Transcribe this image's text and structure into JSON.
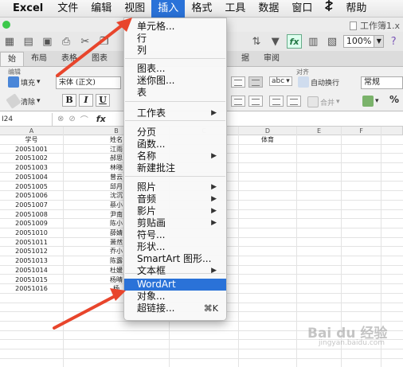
{
  "menubar": {
    "items": [
      "Excel",
      "文件",
      "编辑",
      "视图",
      "插入",
      "格式",
      "工具",
      "数据",
      "窗口",
      "帮助"
    ],
    "script_icon": "script-icon",
    "active": "插入"
  },
  "window": {
    "title": "工作簿1.x"
  },
  "toolbar": {
    "zoom": "100%",
    "fx": "fx"
  },
  "ribbon": {
    "tabs": [
      "始",
      "布局",
      "表格",
      "图表",
      "",
      "",
      "据",
      "审阅"
    ],
    "groups": {
      "edit": "编辑",
      "align": "对齐"
    },
    "fill": "填充",
    "clear": "清除",
    "font": "宋体 (正文)",
    "bold": "B",
    "italic": "I",
    "underline": "U",
    "wrap": "自动换行",
    "merge": "合并",
    "number_format": "常规",
    "abc": "abc",
    "percent": "%"
  },
  "formula_bar": {
    "cell_ref": "I24",
    "fx": "fx"
  },
  "grid": {
    "columns": [
      "A",
      "B",
      "C",
      "D",
      "E",
      "F"
    ],
    "header_row": [
      "学号",
      "姓名",
      "",
      "体育",
      "",
      ""
    ],
    "ids": [
      "20051001",
      "20051002",
      "20051003",
      "20051004",
      "20051005",
      "20051006",
      "20051007",
      "20051008",
      "20051009",
      "20051010",
      "20051011",
      "20051012",
      "20051013",
      "20051014",
      "20051015",
      "20051016"
    ],
    "names": [
      "江雨",
      "郝思",
      "林晓",
      "曾云",
      "邱月",
      "沈沉",
      "蔡小",
      "尹南",
      "陈小",
      "薛婧",
      "萧然",
      "乔小",
      "陈露",
      "杜媛",
      "杨晴",
      "杨"
    ]
  },
  "insert_menu": {
    "items": [
      {
        "label": "单元格...",
        "submenu": false
      },
      {
        "label": "行",
        "submenu": false
      },
      {
        "label": "列",
        "submenu": false
      },
      {
        "label": "图表...",
        "submenu": false
      },
      {
        "label": "迷你图...",
        "submenu": false
      },
      {
        "label": "表",
        "submenu": false
      },
      {
        "label": "工作表",
        "submenu": true
      },
      {
        "label": "分页",
        "submenu": false
      },
      {
        "label": "函数...",
        "submenu": false
      },
      {
        "label": "名称",
        "submenu": true
      },
      {
        "label": "新建批注",
        "submenu": false
      },
      {
        "label": "照片",
        "submenu": true
      },
      {
        "label": "音频",
        "submenu": true
      },
      {
        "label": "影片",
        "submenu": true
      },
      {
        "label": "剪贴画",
        "submenu": true
      },
      {
        "label": "符号...",
        "submenu": false
      },
      {
        "label": "形状...",
        "submenu": false
      },
      {
        "label": "SmartArt 图形...",
        "submenu": false
      },
      {
        "label": "文本框",
        "submenu": true
      },
      {
        "label": "WordArt",
        "submenu": false,
        "highlighted": true
      },
      {
        "label": "对象...",
        "submenu": false
      },
      {
        "label": "超链接...",
        "submenu": false,
        "shortcut": "⌘K"
      }
    ]
  },
  "watermark": {
    "text": "Bai du 经验",
    "sub": "jingyan.baidu.com"
  },
  "colors": {
    "menu_highlight": "#2a72d8",
    "arrow": "#e8452c"
  }
}
